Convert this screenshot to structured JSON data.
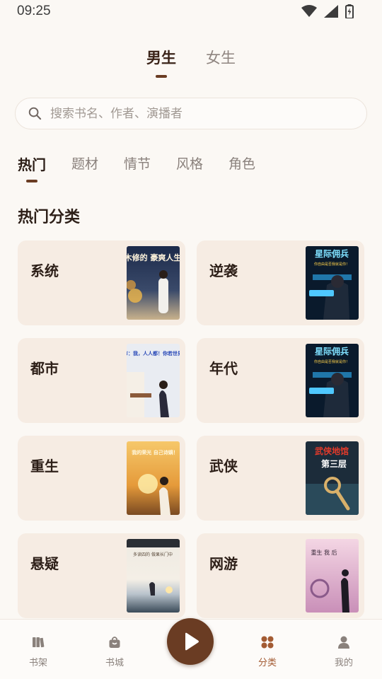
{
  "status_bar": {
    "time": "09:25"
  },
  "gender_tabs": [
    {
      "label": "男生",
      "active": true
    },
    {
      "label": "女生",
      "active": false
    }
  ],
  "search": {
    "placeholder": "搜索书名、作者、演播者"
  },
  "category_tabs": [
    {
      "label": "热门",
      "active": true
    },
    {
      "label": "题材",
      "active": false
    },
    {
      "label": "情节",
      "active": false
    },
    {
      "label": "风格",
      "active": false
    },
    {
      "label": "角色",
      "active": false
    }
  ],
  "section": {
    "title": "热门分类"
  },
  "categories": [
    {
      "label": "系统",
      "cover_title": "木修的 豪爽人生"
    },
    {
      "label": "逆袭",
      "cover_title": "星际佣兵",
      "cover_subtitle": "你自由是否我就是你！"
    },
    {
      "label": "都市",
      "cover_title": "都市：我，人人都！你若世界！"
    },
    {
      "label": "年代",
      "cover_title": "星际佣兵",
      "cover_subtitle": "你自由是否我就是你！"
    },
    {
      "label": "重生",
      "cover_title": "我的荣光 自己诗嫡！"
    },
    {
      "label": "武侠",
      "cover_title": "武侠地馆",
      "cover_subtitle": "第三层"
    },
    {
      "label": "悬疑",
      "cover_title": "多读四的 做果长门中"
    },
    {
      "label": "网游",
      "cover_title": "重生 我 后"
    }
  ],
  "bottom_nav": [
    {
      "label": "书架",
      "icon": "bookshelf-icon",
      "active": false
    },
    {
      "label": "书城",
      "icon": "store-bag-icon",
      "active": false
    },
    {
      "label": "分类",
      "icon": "category-dots-icon",
      "active": true
    },
    {
      "label": "我的",
      "icon": "profile-icon",
      "active": false
    }
  ],
  "colors": {
    "accent": "#6a3c23",
    "active_nav": "#a35b33",
    "card_bg": "#f6ece3",
    "page_bg": "#fbf8f4"
  }
}
